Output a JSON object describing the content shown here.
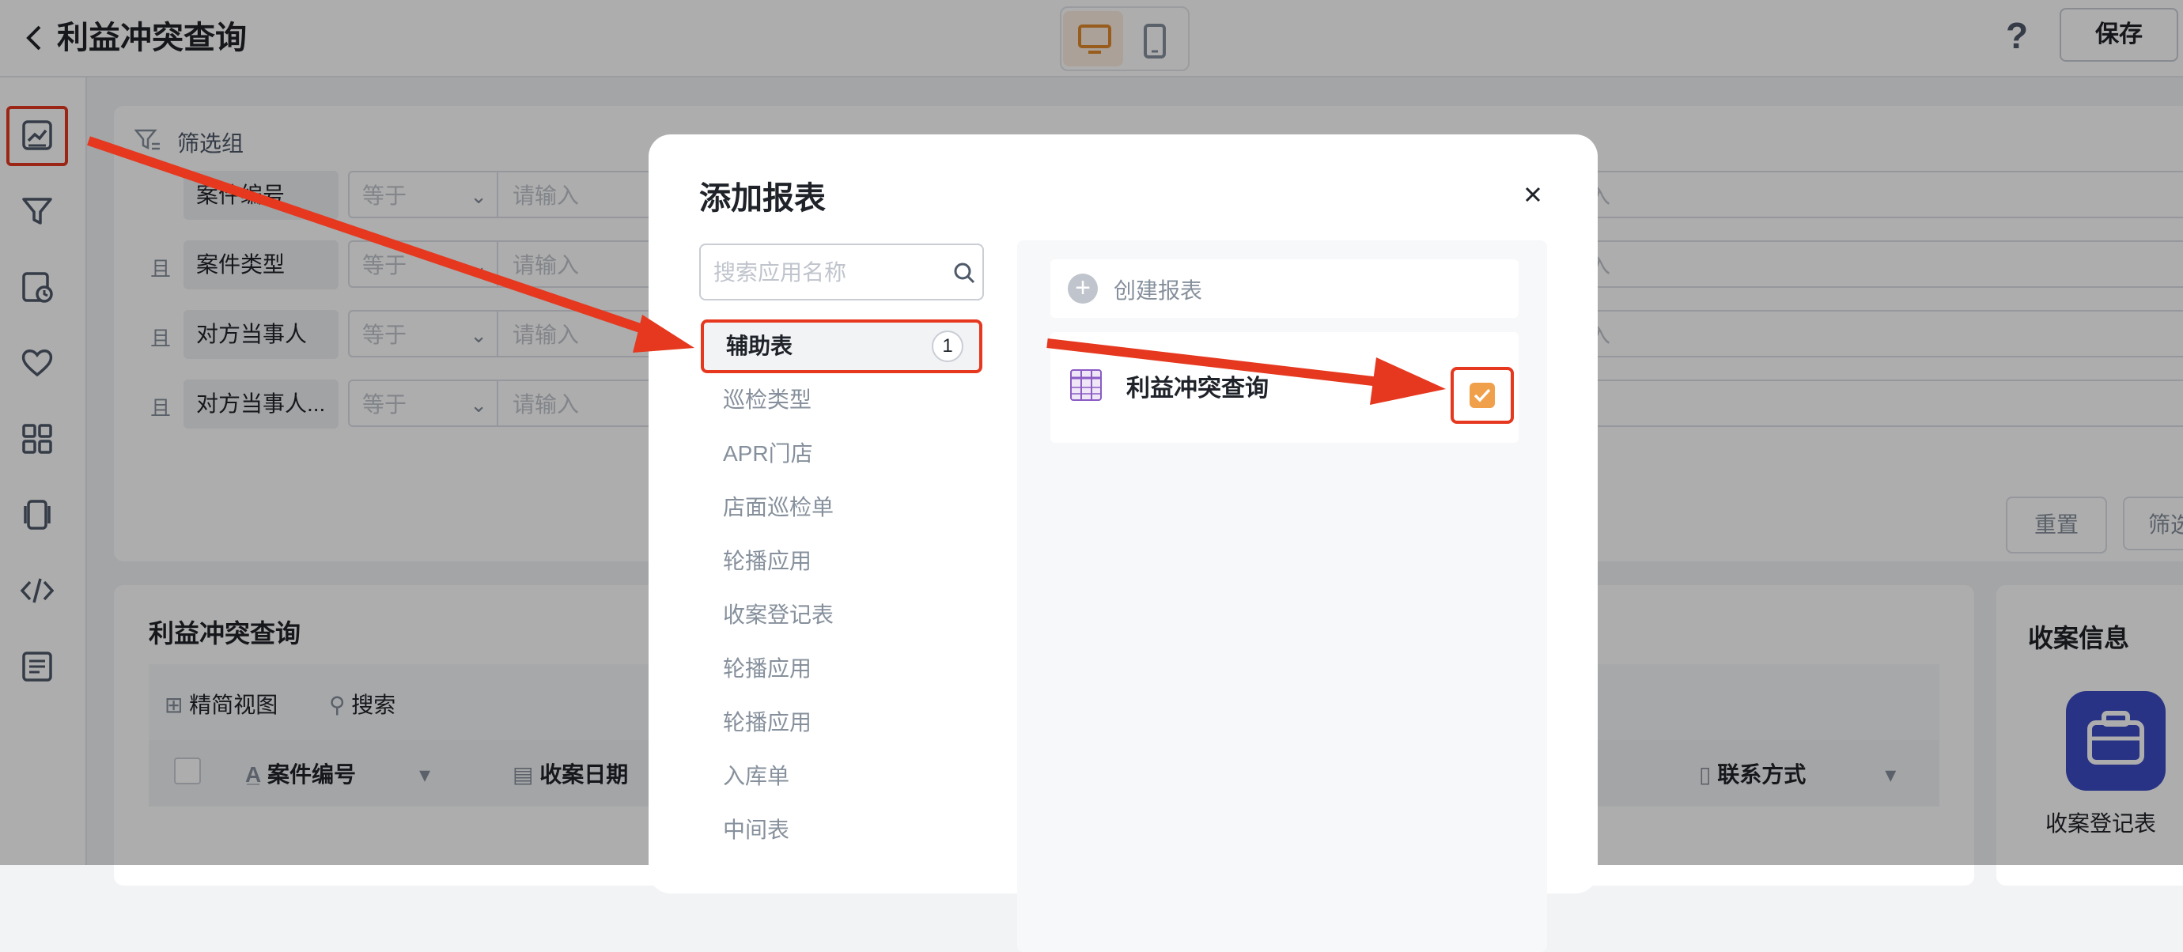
{
  "header": {
    "title": "利益冲突查询",
    "save_label": "保存",
    "help_label": "?"
  },
  "filter": {
    "group_title": "筛选组",
    "rows": [
      {
        "conj": "",
        "field": "案件编号",
        "op": "等于",
        "placeholder": "请输入"
      },
      {
        "conj": "且",
        "field": "案件类型",
        "op": "等于",
        "placeholder": "请输入"
      },
      {
        "conj": "且",
        "field": "对方当事人",
        "op": "等于",
        "placeholder": "请输入"
      },
      {
        "conj": "且",
        "field": "对方当事人...",
        "op": "等于",
        "placeholder": "请输入"
      }
    ],
    "right_placeholder": "入",
    "reset_label": "重置",
    "filter_label": "筛选"
  },
  "report": {
    "title": "利益冲突查询",
    "view_label": "精简视图",
    "search_label": "搜索",
    "columns": [
      "案件编号",
      "收案日期",
      "联系方式"
    ]
  },
  "side": {
    "title": "收案信息",
    "app_label": "收案登记表"
  },
  "modal": {
    "title": "添加报表",
    "search_placeholder": "搜索应用名称",
    "apps": [
      {
        "label": "辅助表",
        "count": "1",
        "active": true
      },
      {
        "label": "巡检类型"
      },
      {
        "label": "APR门店"
      },
      {
        "label": "店面巡检单"
      },
      {
        "label": "轮播应用"
      },
      {
        "label": "收案登记表"
      },
      {
        "label": "轮播应用"
      },
      {
        "label": "轮播应用"
      },
      {
        "label": "入库单"
      },
      {
        "label": "中间表"
      }
    ],
    "create_label": "创建报表",
    "report_name": "利益冲突查询",
    "checked": true
  },
  "colors": {
    "accent": "#f0a04b",
    "annotation": "#e5381f",
    "app_tile": "#3b4cc5"
  }
}
